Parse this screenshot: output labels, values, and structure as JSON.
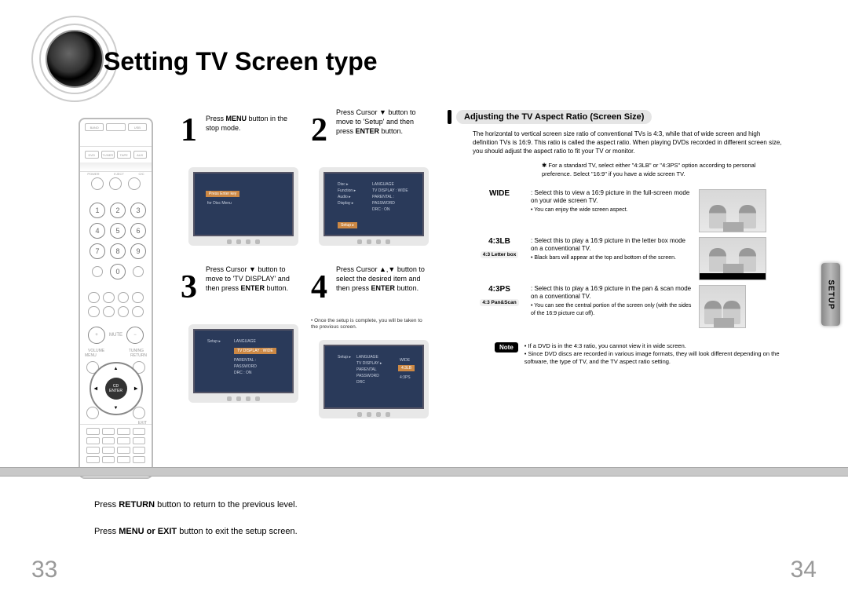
{
  "title": "Setting TV Screen type",
  "sideTab": "SETUP",
  "steps": {
    "s1": {
      "num": "1",
      "textA": "Press ",
      "bold": "MENU",
      "textB": " button in the stop mode."
    },
    "s2": {
      "num": "2",
      "textA": "Press Cursor ▼ button to move to 'Setup' and then press ",
      "bold": "ENTER",
      "textB": " button."
    },
    "s3": {
      "num": "3",
      "textA": "Press Cursor ▼ button to move to 'TV DISPLAY' and then press ",
      "bold": "ENTER",
      "textB": " button."
    },
    "s4": {
      "num": "4",
      "textA": "Press Cursor ▲,▼ button to select the desired item and then press ",
      "bold": "ENTER",
      "textB": " button."
    },
    "note4": "• Once the setup is complete, you will be taken to the previous screen."
  },
  "right": {
    "header": "Adjusting the TV Aspect Ratio (Screen Size)",
    "intro": "The horizontal to vertical screen size ratio of conventional TVs is 4:3, while that of wide screen and high definition TVs is 16:9. This ratio is called the aspect ratio. When playing DVDs recorded in different screen size, you should adjust the aspect ratio to fit your TV or monitor.",
    "star": "✱ For a standard TV, select either \"4:3LB\" or \"4:3PS\" option according to personal preference. Select \"16:9\" if you have a wide screen TV.",
    "wide": {
      "label": "WIDE",
      "desc": ": Select this to view a 16:9 picture in the full-screen mode on your wide screen TV.",
      "bullet": "• You can enjoy the wide screen aspect."
    },
    "lb": {
      "label": "4:3LB",
      "sub": "4:3 Letter box",
      "desc": ": Select this to play a 16:9 picture in the letter box mode on a conventional TV.",
      "bullet": "• Black bars will appear at the top and bottom of the screen."
    },
    "ps": {
      "label": "4:3PS",
      "sub": "4:3 Pan&Scan",
      "desc": ": Select this to play a 16:9 picture in the pan & scan mode on a conventional TV.",
      "bullet": "• You can see the central portion of the screen only (with the sides of the 16:9 picture cut off)."
    },
    "noteLabel": "Note",
    "note1": "• If a DVD is in the 4:3 ratio, you cannot view it in wide screen.",
    "note2": "• Since DVD discs are recorded in various image formats, they will look different depending on the software, the type of TV, and the TV aspect ratio setting."
  },
  "footer": {
    "line1a": "Press ",
    "line1b": "RETURN",
    "line1c": " button to return to the previous level.",
    "line2a": "Press ",
    "line2b": "MENU or EXIT",
    "line2c": " button to exit the setup screen."
  },
  "pages": {
    "left": "33",
    "right": "34"
  },
  "remote": {
    "topBtns": [
      "BAND",
      "USB"
    ],
    "topBtns2": [
      "DVD",
      "TUNER",
      "TAPE",
      "AUX"
    ],
    "labels1": [
      "POWER",
      "EJECT",
      "OPEN/CLOSE"
    ],
    "nums": [
      "1",
      "2",
      "3",
      "4",
      "5",
      "6",
      "7",
      "8",
      "9",
      "",
      "0",
      ""
    ],
    "vol": [
      "+",
      "−"
    ],
    "menu": "MENU",
    "return": "RETURN",
    "enter": "CD ENTER"
  }
}
